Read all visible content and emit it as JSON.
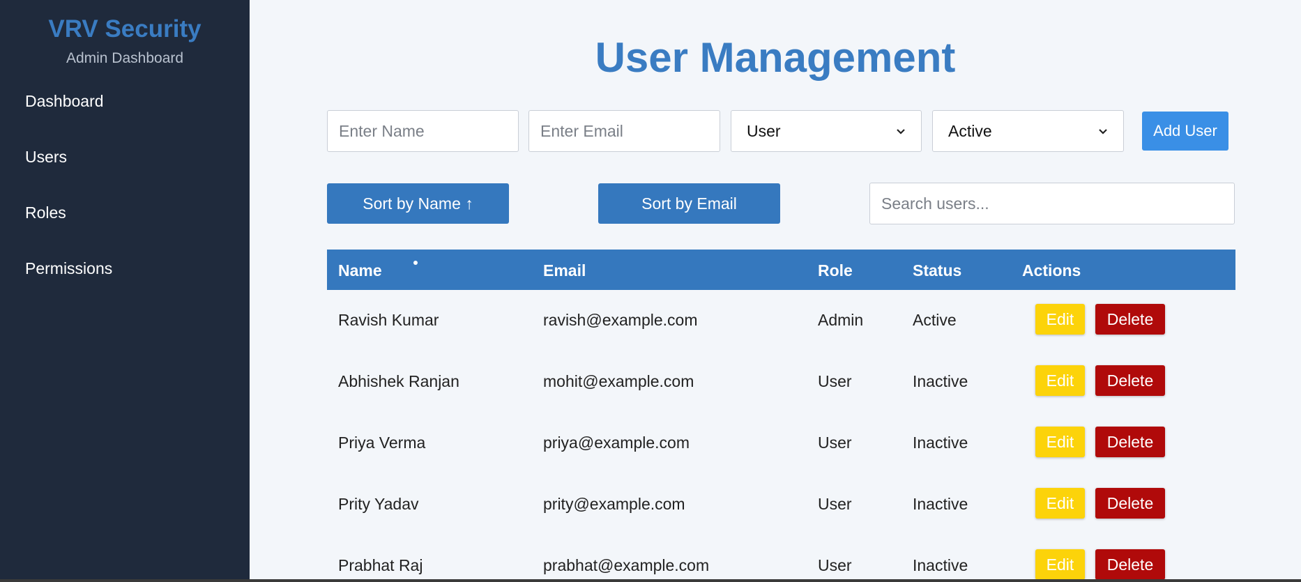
{
  "sidebar": {
    "brand": "VRV Security",
    "subtitle": "Admin Dashboard",
    "items": [
      {
        "label": "Dashboard"
      },
      {
        "label": "Users"
      },
      {
        "label": "Roles"
      },
      {
        "label": "Permissions"
      }
    ]
  },
  "main": {
    "title": "User Management",
    "form": {
      "name_placeholder": "Enter Name",
      "email_placeholder": "Enter Email",
      "role_selected": "User",
      "status_selected": "Active",
      "add_label": "Add User"
    },
    "controls": {
      "sort_name_label": "Sort by Name ↑",
      "sort_email_label": "Sort by Email",
      "search_placeholder": "Search users..."
    },
    "table": {
      "headers": [
        "Name",
        "Email",
        "Role",
        "Status",
        "Actions"
      ],
      "edit_label": "Edit",
      "delete_label": "Delete",
      "rows": [
        {
          "name": "Ravish Kumar",
          "email": "ravish@example.com",
          "role": "Admin",
          "status": "Active"
        },
        {
          "name": "Abhishek Ranjan",
          "email": "mohit@example.com",
          "role": "User",
          "status": "Inactive"
        },
        {
          "name": "Priya Verma",
          "email": "priya@example.com",
          "role": "User",
          "status": "Inactive"
        },
        {
          "name": "Prity Yadav",
          "email": "prity@example.com",
          "role": "User",
          "status": "Inactive"
        },
        {
          "name": "Prabhat Raj",
          "email": "prabhat@example.com",
          "role": "User",
          "status": "Inactive"
        }
      ]
    }
  },
  "icons": {
    "select_chevron": "chevron-down-icon"
  },
  "colors": {
    "sidebar_bg": "#1f2a3c",
    "brand": "#3a7cc2",
    "primary": "#3578be",
    "add_button": "#3a8fe6",
    "edit_button": "#fcd30a",
    "delete_button": "#b00a0a"
  }
}
